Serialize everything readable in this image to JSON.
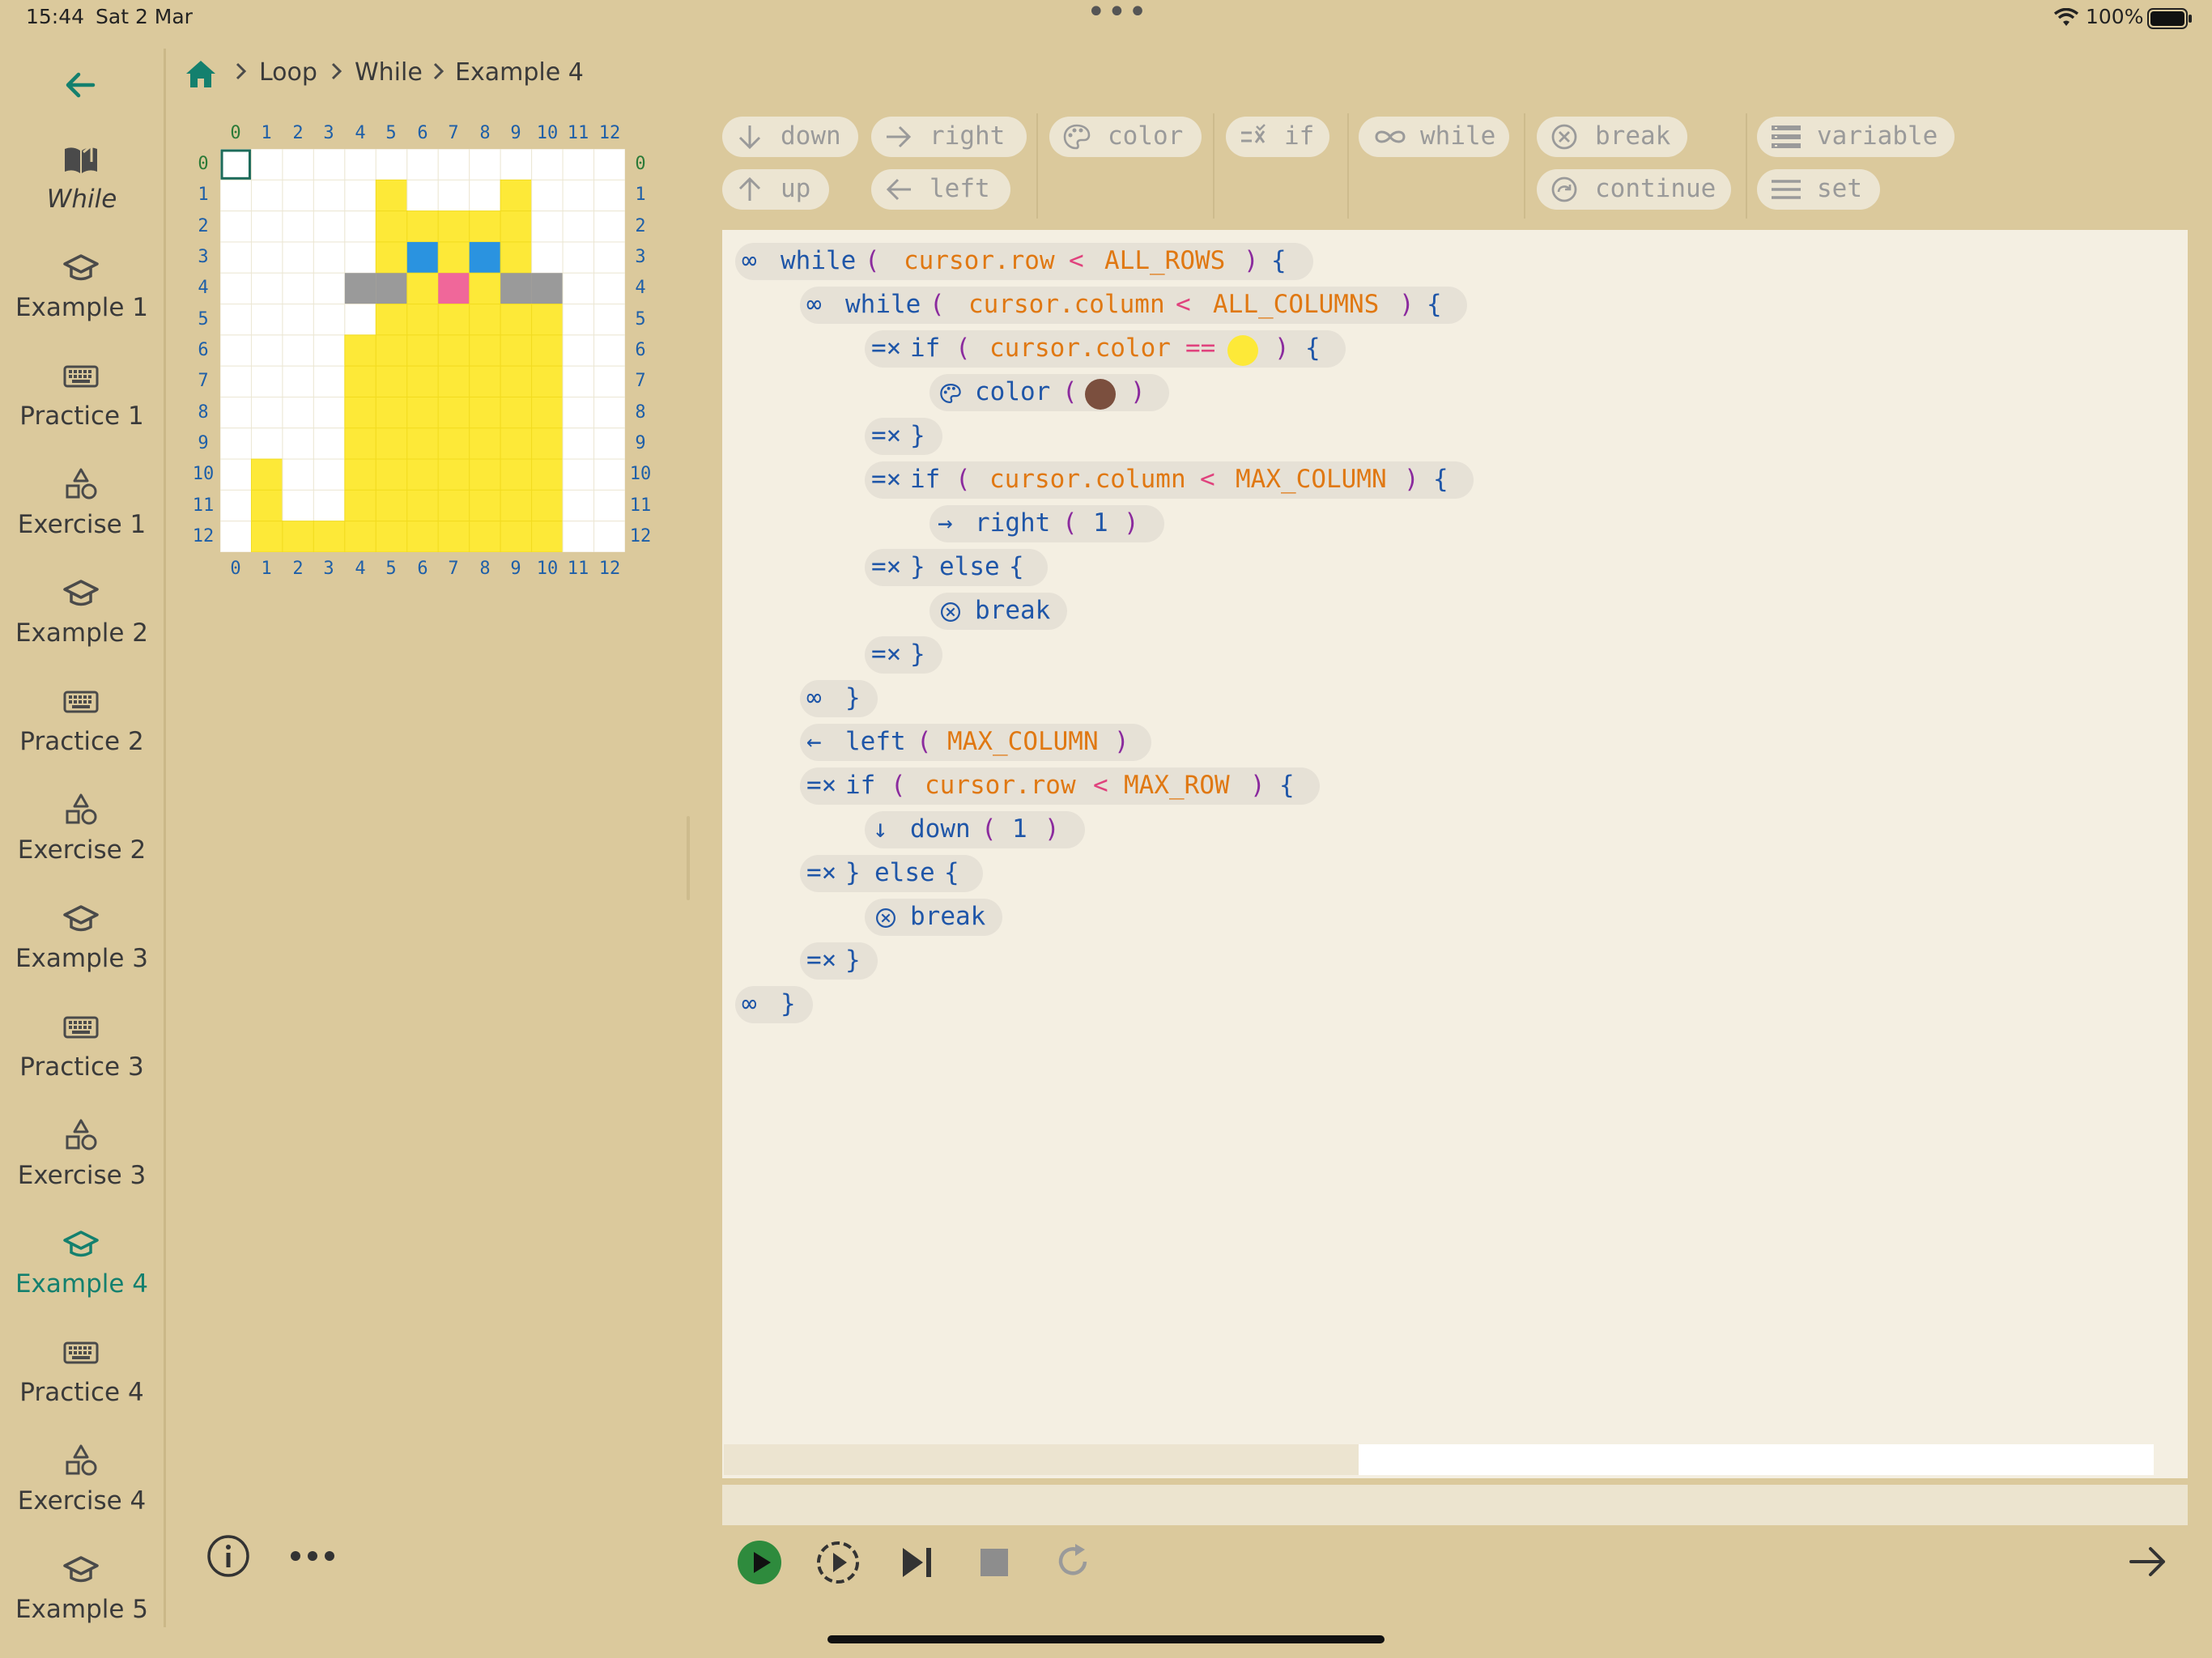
{
  "status": {
    "time": "15:44",
    "date": "Sat 2 Mar",
    "more": "•••",
    "battery": "100%"
  },
  "breadcrumb": [
    "Loop",
    "While",
    "Example 4"
  ],
  "sidebar": {
    "items": [
      {
        "label": "While",
        "icon": "book-icon"
      },
      {
        "label": "Example 1",
        "icon": "graduation-cap-icon"
      },
      {
        "label": "Practice 1",
        "icon": "keyboard-icon"
      },
      {
        "label": "Exercise 1",
        "icon": "shapes-icon"
      },
      {
        "label": "Example 2",
        "icon": "graduation-cap-icon"
      },
      {
        "label": "Practice 2",
        "icon": "keyboard-icon"
      },
      {
        "label": "Exercise 2",
        "icon": "shapes-icon"
      },
      {
        "label": "Example 3",
        "icon": "graduation-cap-icon"
      },
      {
        "label": "Practice 3",
        "icon": "keyboard-icon"
      },
      {
        "label": "Exercise 3",
        "icon": "shapes-icon"
      },
      {
        "label": "Example 4",
        "icon": "graduation-cap-icon"
      },
      {
        "label": "Practice 4",
        "icon": "keyboard-icon"
      },
      {
        "label": "Exercise 4",
        "icon": "shapes-icon"
      },
      {
        "label": "Example 5",
        "icon": "graduation-cap-icon"
      }
    ],
    "active": "Example 4"
  },
  "grid": {
    "col_labels": [
      "0",
      "1",
      "2",
      "3",
      "4",
      "5",
      "6",
      "7",
      "8",
      "9",
      "10",
      "11",
      "12"
    ],
    "row_labels": [
      "0",
      "1",
      "2",
      "3",
      "4",
      "5",
      "6",
      "7",
      "8",
      "9",
      "10",
      "11",
      "12"
    ],
    "colors": {
      "W": "#ffffff",
      "Y": "#fde938",
      "B": "#2a93e0",
      "G": "#9a9a9a",
      "P": "#f0679a"
    },
    "cells": [
      "WWWWWWWWWWWWW",
      "WWWWWYWWWYWWW",
      "WWWWWYYYYYWWW",
      "WWWWWYBYBYWWW",
      "WWWWGGYPYGGWW",
      "WWWWWYYYYYYWW",
      "WWWWYYYYYYYWW",
      "WWWWYYYYYYYWW",
      "WWWWYYYYYYYWW",
      "WWWWYYYYYYYWW",
      "WYWWYYYYYYYWW",
      "WYWWYYYYYYYWW",
      "WYYYYYYYYYYWW"
    ],
    "cursor": {
      "row": 0,
      "col": 0
    }
  },
  "palette": {
    "down": "down",
    "up": "up",
    "right": "right",
    "left": "left",
    "color": "color",
    "if": "if",
    "while": "while",
    "break": "break",
    "continue": "continue",
    "variable": "variable",
    "set": "set"
  },
  "code": {
    "while": "while",
    "if": "if",
    "else": "else",
    "color": "color",
    "right": "right",
    "left": "left",
    "down": "down",
    "break": "break",
    "open_paren": "(",
    "close_paren": ")",
    "open_brace": "{",
    "close_brace": "}",
    "lt": "<",
    "eq": "==",
    "one": "1",
    "cursor_row": "cursor.row",
    "cursor_column": "cursor.column",
    "cursor_color": "cursor.color",
    "all_rows": "ALL_ROWS",
    "all_columns": "ALL_COLUMNS",
    "max_column": "MAX_COLUMN",
    "max_row": "MAX_ROW",
    "yellow_swatch": "#fde938",
    "brown_swatch": "#7b4f3e"
  },
  "colors": {
    "accent": "#14806e",
    "run": "#2e8b3d",
    "background": "#dbc99c",
    "editor": "#f4efe2"
  }
}
